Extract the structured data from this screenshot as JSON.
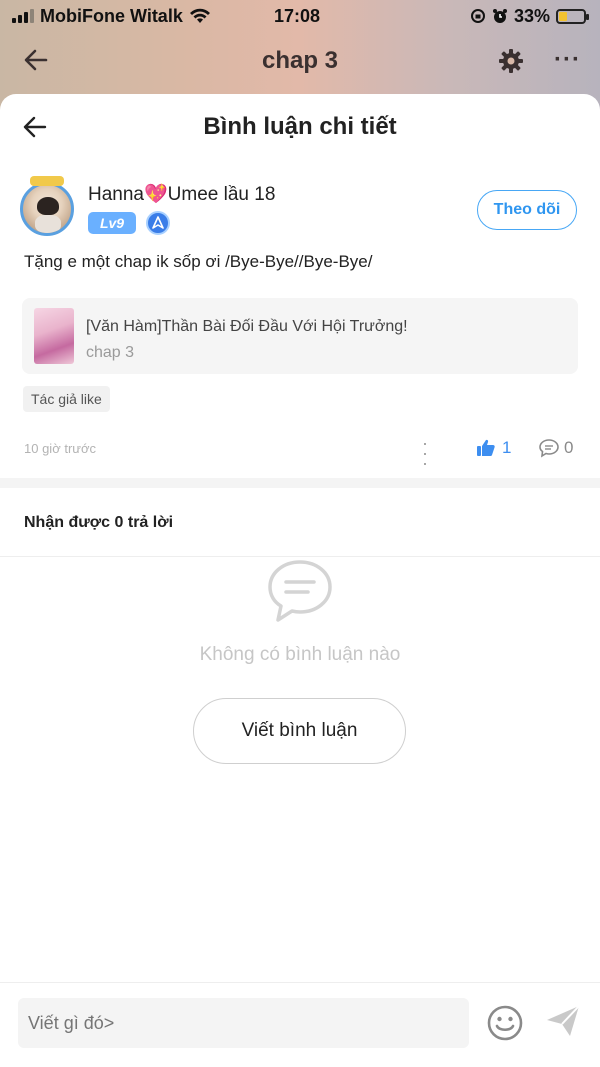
{
  "status_bar": {
    "carrier": "MobiFone Witalk",
    "time": "17:08",
    "battery": "33%",
    "battery_fill_fraction": 0.33
  },
  "app_header": {
    "title": "chap 3",
    "icons": [
      "back-arrow-icon",
      "gear-icon",
      "more-icon"
    ]
  },
  "sheet": {
    "title": "Bình luận chi tiết",
    "user": {
      "name_part1": "Hanna",
      "emoji": "💖",
      "name_part2": "Umee lầu 18",
      "level": "Lv9",
      "follow_label": "Theo dõi"
    },
    "comment": "Tặng e một chap ik sốp ơi /Bye-Bye//Bye-Bye/",
    "reference": {
      "title": "[Văn Hàm]Thần Bài Đối Đầu Với Hội Trưởng!",
      "subtitle": "chap 3"
    },
    "tag": "Tác giả like",
    "time": "10 giờ trước",
    "likes": "1",
    "replies": "0",
    "replies_label": "Nhận được 0 trả lời",
    "empty_text": "Không có bình luận nào",
    "write_button": "Viết bình luận"
  },
  "input": {
    "placeholder": "Viết gì đó>"
  },
  "colors": {
    "accent_blue": "#2f96f0",
    "level_badge": "#6ab0ff",
    "battery": "#f2c230"
  }
}
